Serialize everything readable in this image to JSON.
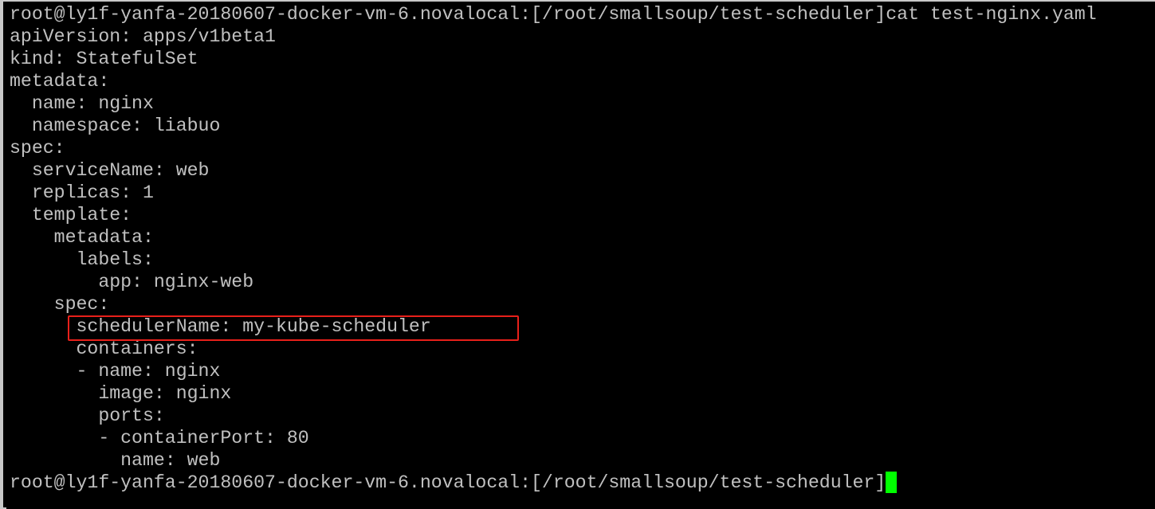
{
  "terminal": {
    "lines": [
      "root@ly1f-yanfa-20180607-docker-vm-6.novalocal:[/root/smallsoup/test-scheduler]cat test-nginx.yaml",
      "apiVersion: apps/v1beta1",
      "kind: StatefulSet",
      "metadata:",
      "  name: nginx",
      "  namespace: liabuo",
      "spec:",
      "  serviceName: web",
      "  replicas: 1",
      "  template:",
      "    metadata:",
      "      labels:",
      "        app: nginx-web",
      "    spec:",
      "      schedulerName: my-kube-scheduler",
      "      containers:",
      "      - name: nginx",
      "        image: nginx",
      "        ports:",
      "        - containerPort: 80",
      "          name: web"
    ],
    "prompt": "root@ly1f-yanfa-20180607-docker-vm-6.novalocal:[/root/smallsoup/test-scheduler]",
    "text_color": "#c0c0c0",
    "background_color": "#000000",
    "cursor_color": "#00ff00",
    "highlight_color": "#e8201a"
  }
}
